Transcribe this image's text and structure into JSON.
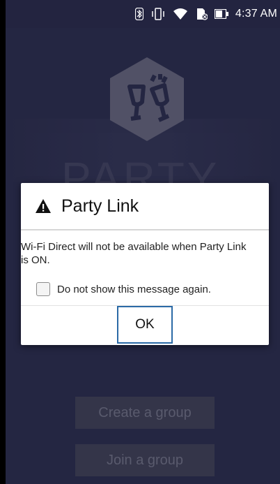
{
  "status_bar": {
    "time": "4:37 AM",
    "icons": [
      "bluetooth-icon",
      "vibrate-icon",
      "wifi-icon",
      "sd-card-icon",
      "battery-icon"
    ]
  },
  "background": {
    "title": "PARTY",
    "create_group_label": "Create a group",
    "join_group_label": "Join a group"
  },
  "dialog": {
    "title": "Party Link",
    "message": "Wi-Fi Direct will not be available when Party Link is ON.",
    "checkbox_label": "Do not show this message again.",
    "checkbox_checked": false,
    "ok_label": "OK"
  },
  "colors": {
    "background": "#3a3d5f",
    "status_bar": "#232440",
    "accent_focus": "#2b6aa6"
  }
}
